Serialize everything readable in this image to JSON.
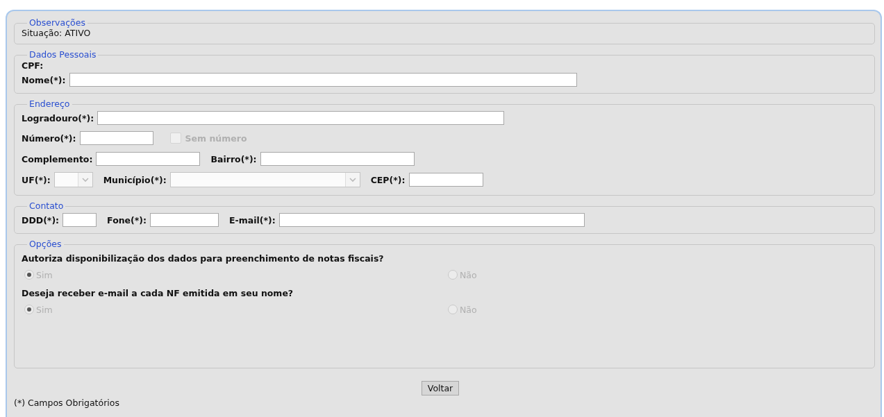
{
  "observacoes": {
    "legend": "Observações",
    "status": "Situação: ATIVO"
  },
  "dados_pessoais": {
    "legend": "Dados Pessoais",
    "cpf_label": "CPF:",
    "nome_label": "Nome(*):"
  },
  "endereco": {
    "legend": "Endereço",
    "logradouro_label": "Logradouro(*):",
    "numero_label": "Número(*):",
    "sem_numero": {
      "label": "Sem número",
      "checked": false,
      "disabled": true
    },
    "complemento_label": "Complemento:",
    "bairro_label": "Bairro(*):",
    "uf_label": "UF(*):",
    "municipio_label": "Município(*):",
    "cep_label": "CEP(*):"
  },
  "contato": {
    "legend": "Contato",
    "ddd_label": "DDD(*):",
    "fone_label": "Fone(*):",
    "email_label": "E-mail(*):"
  },
  "opcoes": {
    "legend": "Opções",
    "questions": [
      {
        "text": "Autoriza disponibilização dos dados para preenchimento de notas fiscais?",
        "disabled": true,
        "options": [
          {
            "label": "Sim",
            "selected": true
          },
          {
            "label": "Não",
            "selected": false
          }
        ]
      },
      {
        "text": "Deseja receber e-mail a cada NF emitida em seu nome?",
        "disabled": true,
        "options": [
          {
            "label": "Sim",
            "selected": true
          },
          {
            "label": "Não",
            "selected": false
          }
        ]
      }
    ]
  },
  "button": "Voltar",
  "footnote": "(*) Campos Obrigatórios"
}
